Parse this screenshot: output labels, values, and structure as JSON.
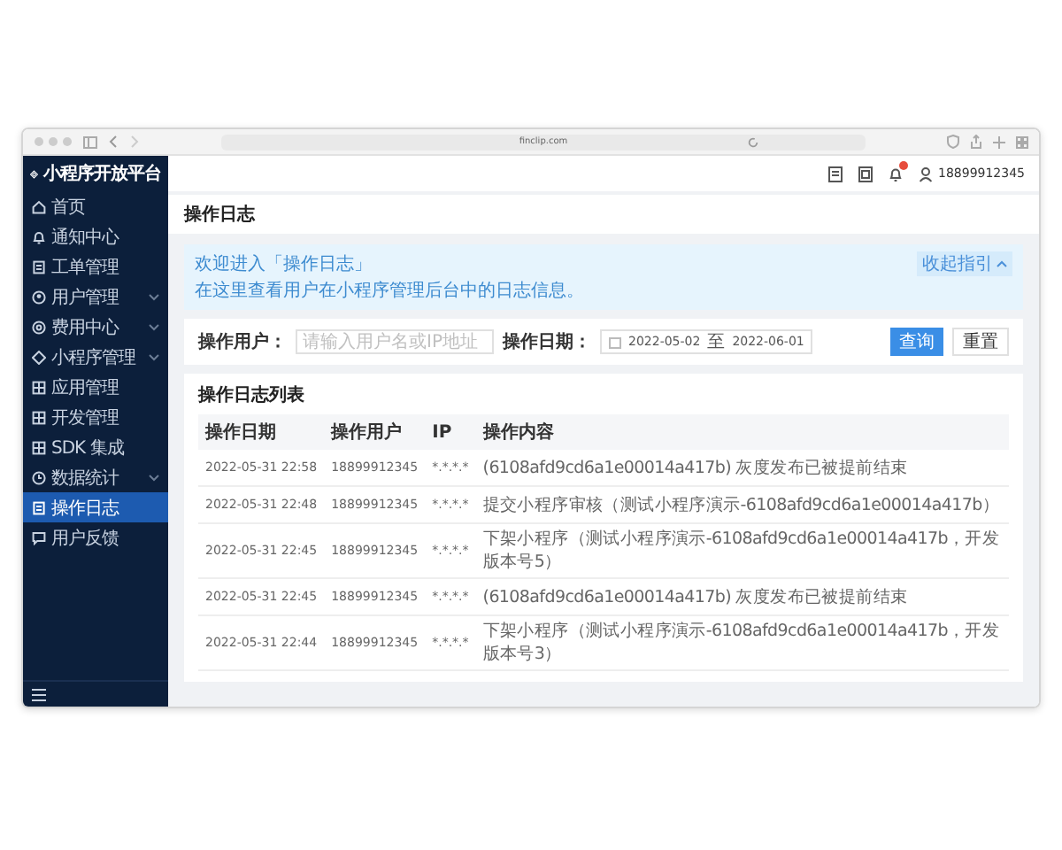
{
  "browser": {
    "url": "finclip.com"
  },
  "sidebar": {
    "logo": "小程序开放平台",
    "items": [
      {
        "label": "首页",
        "expandable": false,
        "selected": false
      },
      {
        "label": "通知中心",
        "expandable": false,
        "selected": false
      },
      {
        "label": "工单管理",
        "expandable": false,
        "selected": false
      },
      {
        "label": "用户管理",
        "expandable": true,
        "selected": false
      },
      {
        "label": "费用中心",
        "expandable": true,
        "selected": false
      },
      {
        "label": "小程序管理",
        "expandable": true,
        "selected": false
      },
      {
        "label": "应用管理",
        "expandable": false,
        "selected": false
      },
      {
        "label": "开发管理",
        "expandable": false,
        "selected": false
      },
      {
        "label": "SDK 集成",
        "expandable": false,
        "selected": false
      },
      {
        "label": "数据统计",
        "expandable": true,
        "selected": false
      },
      {
        "label": "操作日志",
        "expandable": false,
        "selected": true
      },
      {
        "label": "用户反馈",
        "expandable": false,
        "selected": false
      }
    ]
  },
  "topbar": {
    "notification_badge": true,
    "username": "18899912345"
  },
  "page_title": "操作日志",
  "banner": {
    "lines": [
      "欢迎进入「操作日志」",
      "在这里查看用户在小程序管理后台中的日志信息。"
    ],
    "toggle": "收起指引"
  },
  "filters": {
    "user_label": "操作用户：",
    "user_placeholder": "请输入用户名或IP地址",
    "date_label": "操作日期：",
    "date_from": "2022-05-02",
    "date_sep": "至",
    "date_to": "2022-06-01",
    "search_button": "查询",
    "reset_button": "重置"
  },
  "table": {
    "title": "操作日志列表",
    "columns": [
      "操作日期",
      "操作用户",
      "IP",
      "操作内容"
    ],
    "rows": [
      [
        "2022-05-31 22:58",
        "18899912345",
        "*.*.*.*",
        "(6108afd9cd6a1e00014a417b) 灰度发布已被提前结束"
      ],
      [
        "2022-05-31 22:48",
        "18899912345",
        "*.*.*.*",
        "提交小程序审核（测试小程序演示-6108afd9cd6a1e00014a417b）"
      ],
      [
        "2022-05-31 22:45",
        "18899912345",
        "*.*.*.*",
        "下架小程序（测试小程序演示-6108afd9cd6a1e00014a417b，开发版本号5）"
      ],
      [
        "2022-05-31 22:45",
        "18899912345",
        "*.*.*.*",
        "(6108afd9cd6a1e00014a417b) 灰度发布已被提前结束"
      ],
      [
        "2022-05-31 22:44",
        "18899912345",
        "*.*.*.*",
        "下架小程序（测试小程序演示-6108afd9cd6a1e00014a417b，开发版本号3）"
      ]
    ]
  }
}
